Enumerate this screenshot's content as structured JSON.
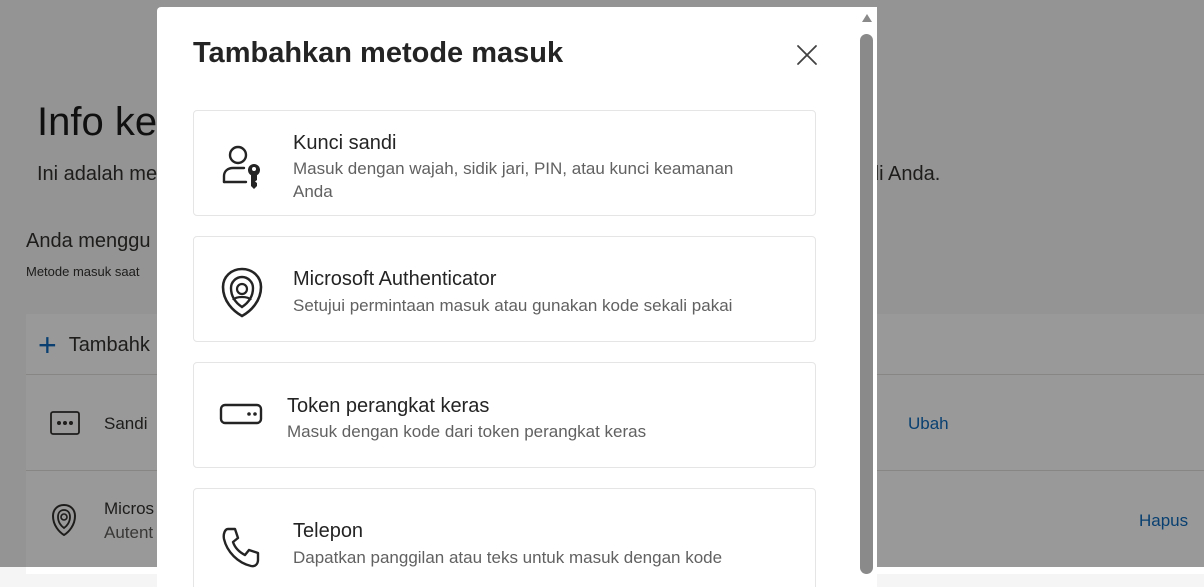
{
  "background": {
    "title": "Info ke",
    "subtitle_left": "Ini adalah me",
    "subtitle_right": "di Anda.",
    "section_heading": "Anda menggu",
    "section_small": "Metode masuk saat",
    "add_button_label": "Tambahk",
    "rows": [
      {
        "label": "Sandi",
        "action": "Ubah"
      },
      {
        "label_line1": "Micros",
        "label_line2": "Autent",
        "action": "Hapus"
      }
    ]
  },
  "dialog": {
    "title": "Tambahkan metode masuk",
    "options": [
      {
        "title": "Kunci sandi",
        "description": "Masuk dengan wajah, sidik jari, PIN, atau kunci keamanan Anda",
        "icon": "passkey-icon"
      },
      {
        "title": "Microsoft Authenticator",
        "description": "Setujui permintaan masuk atau gunakan kode sekali pakai",
        "icon": "authenticator-icon"
      },
      {
        "title": "Token perangkat keras",
        "description": "Masuk dengan kode dari token perangkat keras",
        "icon": "hardware-token-icon"
      },
      {
        "title": "Telepon",
        "description": "Dapatkan panggilan atau teks untuk masuk dengan kode",
        "icon": "phone-icon"
      }
    ]
  }
}
